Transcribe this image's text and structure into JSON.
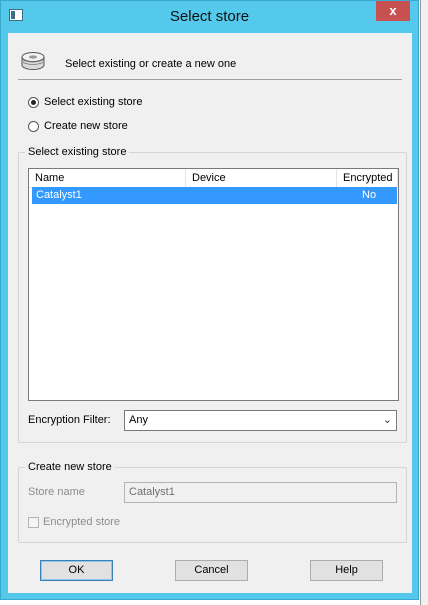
{
  "window": {
    "title": "Select store",
    "close_label": "x"
  },
  "header": {
    "text": "Select existing or create a new one"
  },
  "mode_options": [
    {
      "label": "Select existing store",
      "selected": true
    },
    {
      "label": "Create new store",
      "selected": false
    }
  ],
  "existing_group": {
    "title": "Select existing store",
    "columns": [
      "Name",
      "Device",
      "Encrypted"
    ],
    "rows": [
      {
        "name": "Catalyst1",
        "device": "",
        "encrypted": "No"
      }
    ],
    "filter_label": "Encryption Filter:",
    "filter_value": "Any"
  },
  "new_group": {
    "title": "Create new store",
    "store_name_label": "Store name",
    "store_name_value": "Catalyst1",
    "encrypted_label": "Encrypted store"
  },
  "buttons": {
    "ok": "OK",
    "cancel": "Cancel",
    "help": "Help"
  },
  "colors": {
    "title_bar": "#54c9ec",
    "selection": "#3399ff",
    "close": "#c75050"
  },
  "icons": {
    "app": "window-icon",
    "store": "database-icon",
    "dropdown": "chevron-down-icon"
  }
}
